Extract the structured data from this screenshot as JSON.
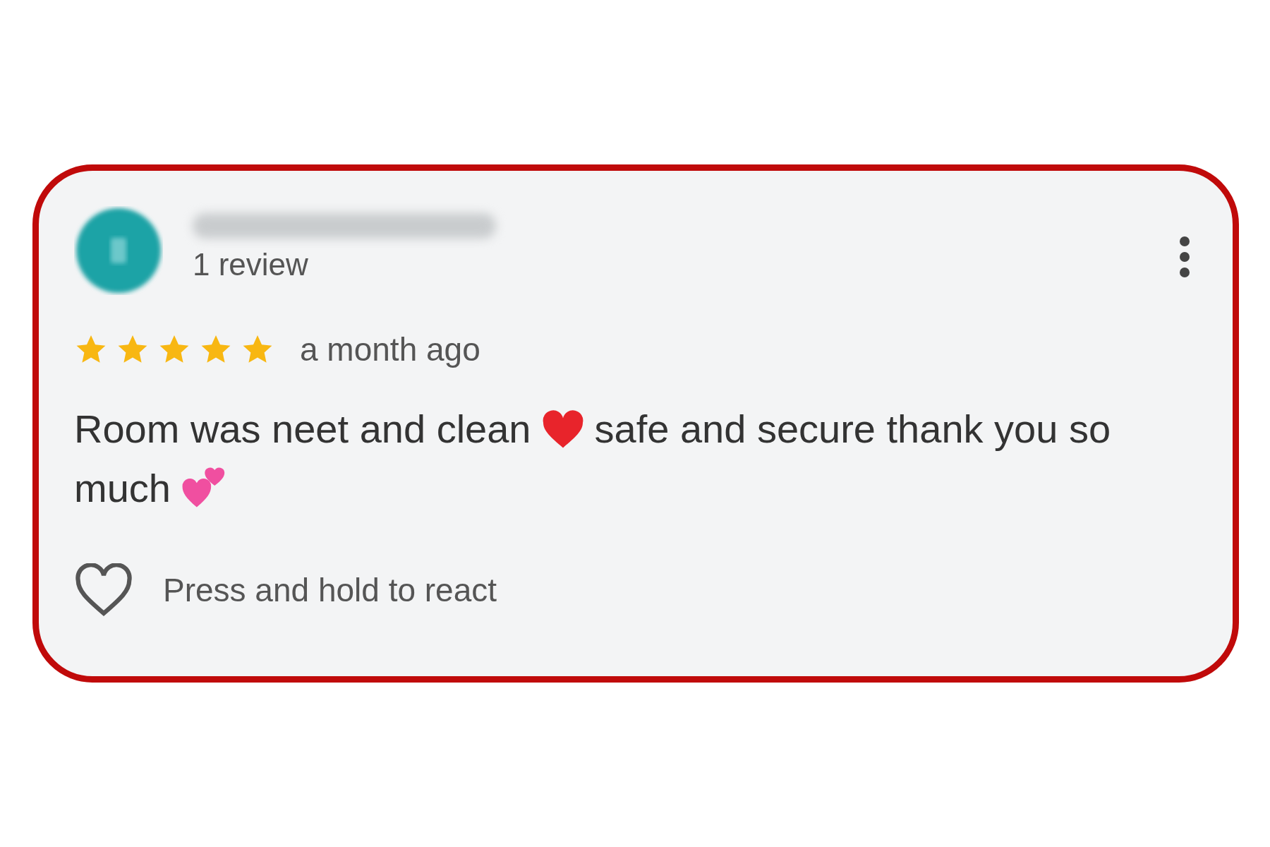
{
  "review": {
    "count": "1 review",
    "stars": 5,
    "time": "a month ago",
    "body": [
      {
        "kind": "text",
        "text": "Room was neet and clean"
      },
      {
        "kind": "red-heart"
      },
      {
        "kind": "text",
        "text": "safe and secure thank you so"
      },
      {
        "kind": "text",
        "text": "much"
      },
      {
        "kind": "two-hearts"
      }
    ],
    "react": {
      "liked": false,
      "label": "Press and hold to react"
    }
  }
}
